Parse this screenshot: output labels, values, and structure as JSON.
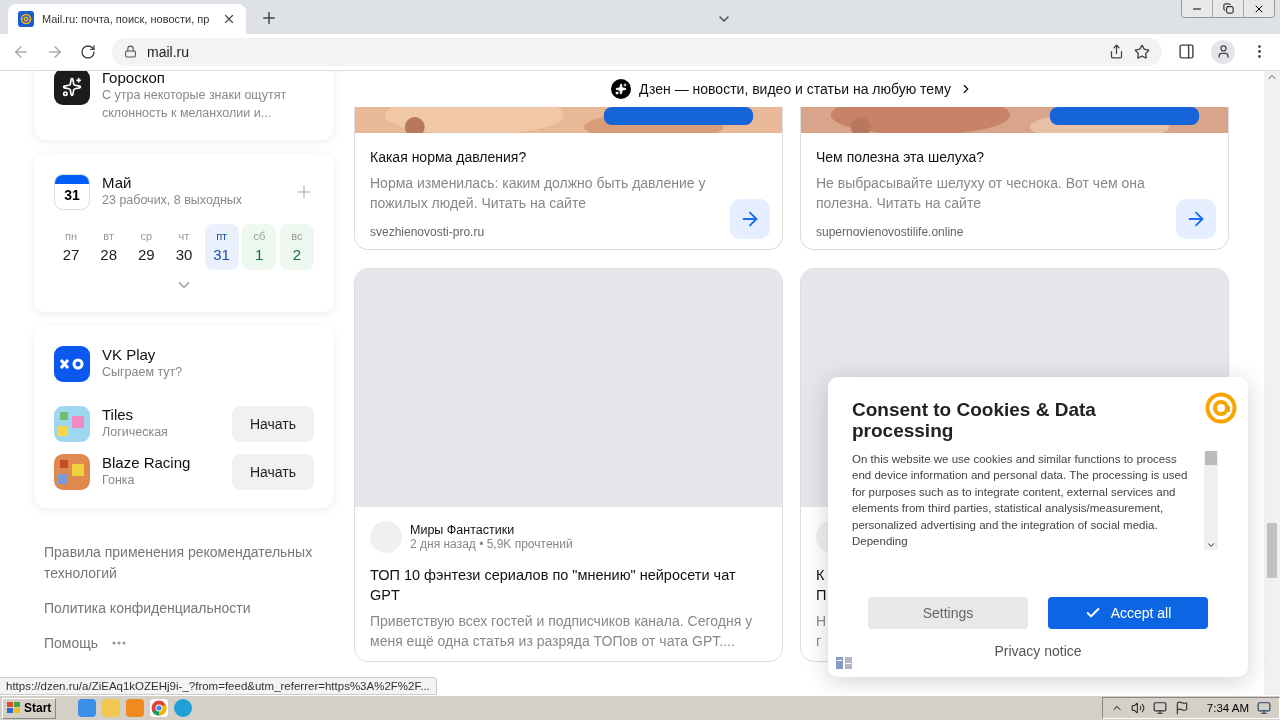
{
  "browser": {
    "tab": {
      "title": "Mail.ru: почта, поиск, новости, пр",
      "selected": true
    },
    "address": "mail.ru"
  },
  "horoscope": {
    "title": "Гороскоп",
    "text": "С утра некоторые знаки ощутят склонность к меланхолии и..."
  },
  "calendar": {
    "badge": "31",
    "month": "Май",
    "summary": "23 рабочих, 8 выходных",
    "days": [
      {
        "weekday": "пн",
        "date": "27",
        "selected": false,
        "weekend": false
      },
      {
        "weekday": "вт",
        "date": "28",
        "selected": false,
        "weekend": false
      },
      {
        "weekday": "ср",
        "date": "29",
        "selected": false,
        "weekend": false
      },
      {
        "weekday": "чт",
        "date": "30",
        "selected": false,
        "weekend": false
      },
      {
        "weekday": "пт",
        "date": "31",
        "selected": true,
        "weekend": false
      },
      {
        "weekday": "сб",
        "date": "1",
        "selected": false,
        "weekend": true
      },
      {
        "weekday": "вс",
        "date": "2",
        "selected": false,
        "weekend": true
      }
    ]
  },
  "games": {
    "title": "VK Play",
    "subtitle": "Сыграем тут?",
    "items": [
      {
        "name": "Tiles",
        "genre": "Логическая",
        "action": "Начать"
      },
      {
        "name": "Blaze Racing",
        "genre": "Гонка",
        "action": "Начать"
      }
    ]
  },
  "footer_links": [
    "Правила применения рекомендательных технологий",
    "Политика конфиденциальности",
    "Помощь"
  ],
  "feed": {
    "header": "Дзен — новости, видео и статьи на любую тему",
    "ads": [
      {
        "title": "Какая норма давления?",
        "text": "Норма изменилась: каким должно быть давление у пожилых людей. Читать на сайте",
        "domain": "svezhienovosti-pro.ru"
      },
      {
        "title": "Чем полезна эта шелуха?",
        "text": "Не выбрасывайте шелуху от чеснока. Вот чем она полезна. Читать на сайте",
        "domain": "supernovienovostilife.online"
      }
    ],
    "article": {
      "channel": "Миры Фантастики",
      "meta": "2 дня назад • 5,9K прочтений",
      "title": "ТОП 10 фэнтези сериалов по \"мнению\" нейросети чат GPT",
      "text": "Приветствую всех гостей и подписчиков канала. Сегодня у меня ещё одна статья из разряда ТОПов от чата GPT...."
    },
    "covered_article": {
      "title_lines": [
        "К",
        "П"
      ],
      "text_lines": [
        "Н",
        "г"
      ]
    }
  },
  "consent": {
    "title": "Consent to Cookies & Data processing",
    "body": "On this website we use cookies and similar functions to process end device information and personal data. The processing is used for purposes such as to integrate content, external services and elements from third parties, statistical analysis/measurement, personalized advertising and the integration of social media. Depending",
    "buttons": [
      {
        "label": "Settings",
        "kind": "secondary"
      },
      {
        "label": "Accept all",
        "kind": "primary"
      }
    ],
    "link": "Privacy notice"
  },
  "status_url": "https://dzen.ru/a/ZiEAq1kOZEHj9i-_?from=feed&utm_referrer=https%3A%2F%2F...",
  "taskbar": {
    "start": "Start",
    "time": "7:34 AM"
  }
}
